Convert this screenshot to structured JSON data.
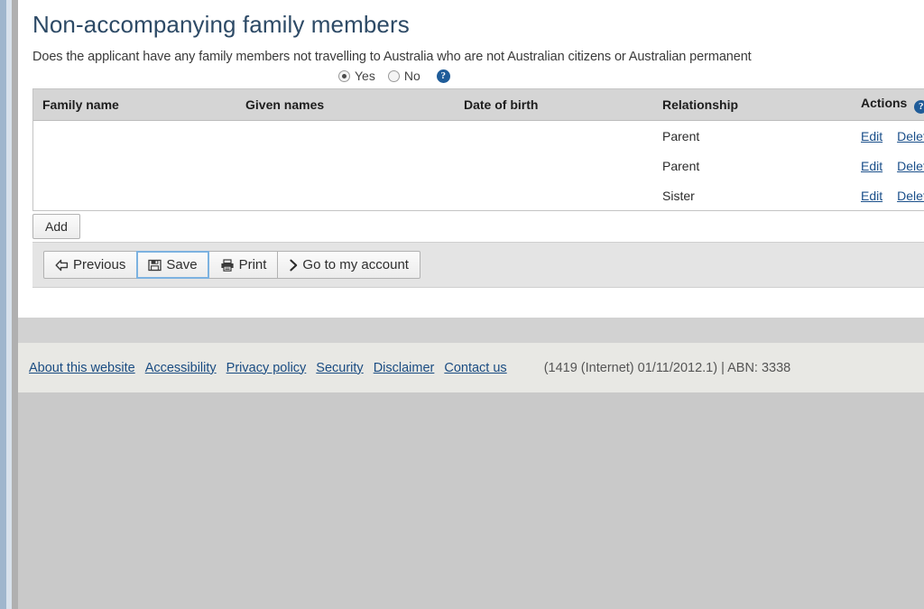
{
  "page": {
    "title": "Non-accompanying family members",
    "question": "Does the applicant have any family members not travelling to Australia who are not Australian citizens or Australian permanent",
    "help_icon": "?"
  },
  "answer": {
    "yes_label": "Yes",
    "no_label": "No",
    "selected": "Yes"
  },
  "table": {
    "headers": {
      "family_name": "Family name",
      "given_names": "Given names",
      "date_of_birth": "Date of birth",
      "relationship": "Relationship",
      "actions": "Actions"
    },
    "actions_help_icon": "?",
    "rows": [
      {
        "family_name": "",
        "given_names": "",
        "date_of_birth": "",
        "relationship": "Parent",
        "edit_label": "Edit",
        "delete_label": "Delete"
      },
      {
        "family_name": "",
        "given_names": "",
        "date_of_birth": "",
        "relationship": "Parent",
        "edit_label": "Edit",
        "delete_label": "Delete"
      },
      {
        "family_name": "",
        "given_names": "",
        "date_of_birth": "",
        "relationship": "Sister",
        "edit_label": "Edit",
        "delete_label": "Delete"
      }
    ]
  },
  "buttons": {
    "add": "Add",
    "previous": "Previous",
    "save": "Save",
    "print": "Print",
    "go_to_account": "Go to my account"
  },
  "footer": {
    "links": [
      "About this website",
      "Accessibility",
      "Privacy policy",
      "Security",
      "Disclaimer",
      "Contact us"
    ],
    "version": "(1419 (Internet) 01/11/2012.1) | ABN: 3338"
  },
  "colors": {
    "title": "#2d4a66",
    "link": "#1a4f8a",
    "help_badge": "#1f5c99",
    "table_header_bg": "#d5d5d5",
    "nav_strip_bg": "#e4e4e4",
    "focus_border": "#7cb2e0",
    "page_bg": "#c9c9c9"
  }
}
